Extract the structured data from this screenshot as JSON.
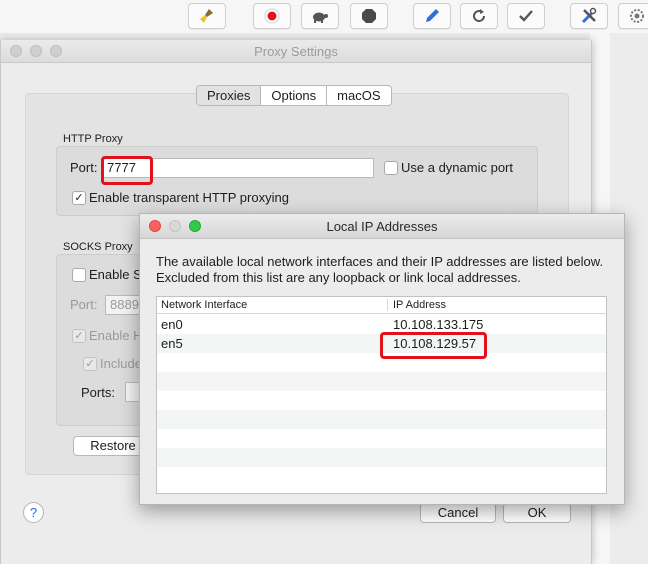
{
  "toolbar": {
    "icons": [
      "broom-icon",
      "record-icon",
      "turtle-icon",
      "stop-icon",
      "pen-icon",
      "refresh-icon",
      "checkmark-icon",
      "tools-icon",
      "gear-icon"
    ],
    "record_color": "#e0121c"
  },
  "proxy_window": {
    "title": "Proxy Settings",
    "tabs": [
      {
        "label": "Proxies",
        "selected": true
      },
      {
        "label": "Options",
        "selected": false
      },
      {
        "label": "macOS",
        "selected": false
      }
    ],
    "http": {
      "group_label": "HTTP Proxy",
      "port_label": "Port:",
      "port_value": "7777",
      "dynamic_port_label": "Use a dynamic port",
      "dynamic_port_checked": false,
      "transparent_label": "Enable transparent HTTP proxying",
      "transparent_checked": true
    },
    "socks": {
      "group_label": "SOCKS Proxy",
      "enable_label": "Enable S",
      "port_label": "Port:",
      "port_value": "8889",
      "enable_h_label": "Enable H",
      "include_label": "Include",
      "ports_label": "Ports:"
    },
    "restore_label": "Restore",
    "help_label": "?",
    "cancel_label": "Cancel",
    "ok_label": "OK"
  },
  "ip_window": {
    "title": "Local IP Addresses",
    "description": "The available local network interfaces and their IP addresses are listed below.  Excluded from this list are any loopback or link local addresses.",
    "columns": [
      "Network Interface",
      "IP Address"
    ],
    "rows": [
      {
        "interface": "en0",
        "ip": "10.108.133.175"
      },
      {
        "interface": "en5",
        "ip": "10.108.129.57"
      }
    ]
  },
  "colors": {
    "highlight_box": "#e0121c",
    "help_accent": "#1f6fe0",
    "close_light": "#fc605c",
    "zoom_light": "#34c84a"
  }
}
